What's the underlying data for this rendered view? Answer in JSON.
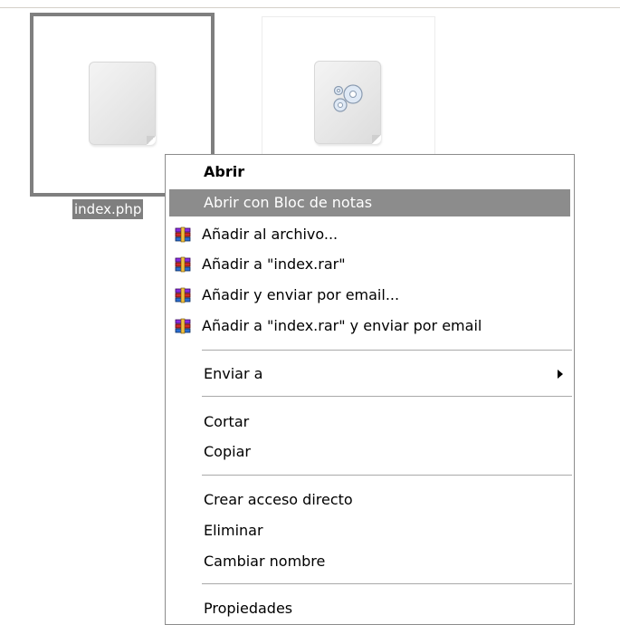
{
  "desktop": {
    "selected_file": {
      "name": "index.php",
      "icon": "php-file-icon"
    },
    "other_file": {
      "icon": "settings-file-icon"
    }
  },
  "context_menu": {
    "items": [
      {
        "label": "Abrir",
        "bold": true
      },
      {
        "label": "Abrir con Bloc de notas",
        "highlighted": true
      },
      {
        "label": "Añadir al archivo...",
        "icon": "winrar-icon"
      },
      {
        "label": "Añadir a \"index.rar\"",
        "icon": "winrar-icon"
      },
      {
        "label": "Añadir y enviar por email...",
        "icon": "winrar-icon"
      },
      {
        "label": "Añadir a \"index.rar\" y enviar por email",
        "icon": "winrar-icon"
      },
      {
        "label": "Enviar a",
        "submenu": true
      },
      {
        "label": "Cortar"
      },
      {
        "label": "Copiar"
      },
      {
        "label": "Crear acceso directo"
      },
      {
        "label": "Eliminar"
      },
      {
        "label": "Cambiar nombre"
      },
      {
        "label": "Propiedades"
      }
    ]
  },
  "colors": {
    "highlight": "#8c8c8c",
    "selection_border": "#7f7f7f",
    "separator": "#a9a9a9"
  }
}
